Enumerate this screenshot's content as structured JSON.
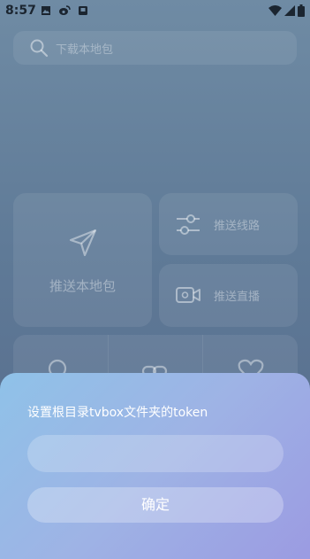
{
  "status_bar": {
    "time": "8:57",
    "left_icons": [
      "image-icon",
      "weibo-icon",
      "notification-icon"
    ],
    "right_icons": [
      "wifi-icon",
      "signal-icon",
      "battery-icon"
    ]
  },
  "search": {
    "placeholder": "下载本地包"
  },
  "tiles": {
    "push_local": {
      "label": "推送本地包",
      "icon": "send-icon"
    },
    "push_line": {
      "label": "推送线路",
      "icon": "sliders-icon"
    },
    "push_live": {
      "label": "推送直播",
      "icon": "video-icon"
    },
    "bottom_icons": [
      "search-icon",
      "link-icon",
      "heart-icon"
    ]
  },
  "dialog": {
    "title": "设置根目录tvbox文件夹的token",
    "input_value": "",
    "confirm_label": "确定"
  },
  "colors": {
    "background": "#6a86a1",
    "sheet_start": "#8fc2e8",
    "sheet_end": "#9b9be2"
  }
}
